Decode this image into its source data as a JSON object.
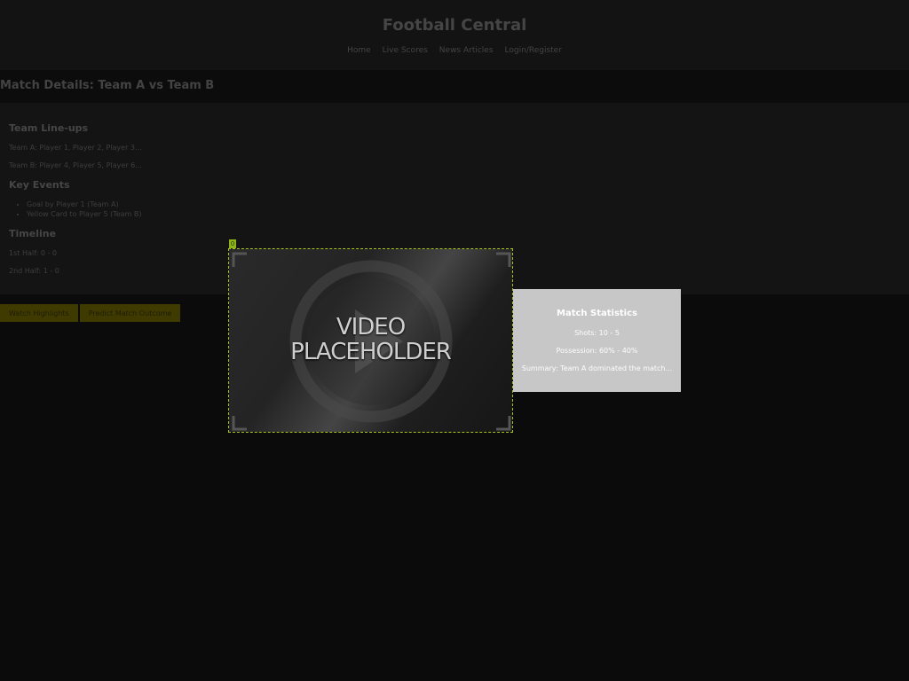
{
  "site": {
    "title": "Football Central"
  },
  "nav": {
    "items": [
      "Home",
      "Live Scores",
      "News Articles",
      "Login/Register"
    ]
  },
  "match": {
    "title": "Match Details: Team A vs Team B"
  },
  "lineups": {
    "heading": "Team Line-ups",
    "team_a": "Team A: Player 1, Player 2, Player 3...",
    "team_b": "Team B: Player 4, Player 5, Player 6..."
  },
  "key_events": {
    "heading": "Key Events",
    "items": [
      "Goal by Player 1 (Team A)",
      "Yellow Card to Player 5 (Team B)"
    ]
  },
  "timeline": {
    "heading": "Timeline",
    "first_half": "1st Half: 0 - 0",
    "second_half": "2nd Half: 1 - 0"
  },
  "actions": {
    "highlights_label": "Watch Highlights",
    "predict_label": "Predict Match Outcome"
  },
  "video": {
    "badge": "0",
    "line1": "VIDEO",
    "line2": "PLACEHOLDER",
    "icon": "play-icon"
  },
  "stats": {
    "heading": "Match Statistics",
    "shots": "Shots: 10 - 5",
    "possession": "Possession: 60% - 40%",
    "summary": "Summary: Team A dominated the match..."
  },
  "colors": {
    "background": "#0b0b0b",
    "header": "#131313",
    "accent_button": "#3f3a00",
    "video_outline": "#a7c41a",
    "stats_panel": "#c7c7c7"
  }
}
